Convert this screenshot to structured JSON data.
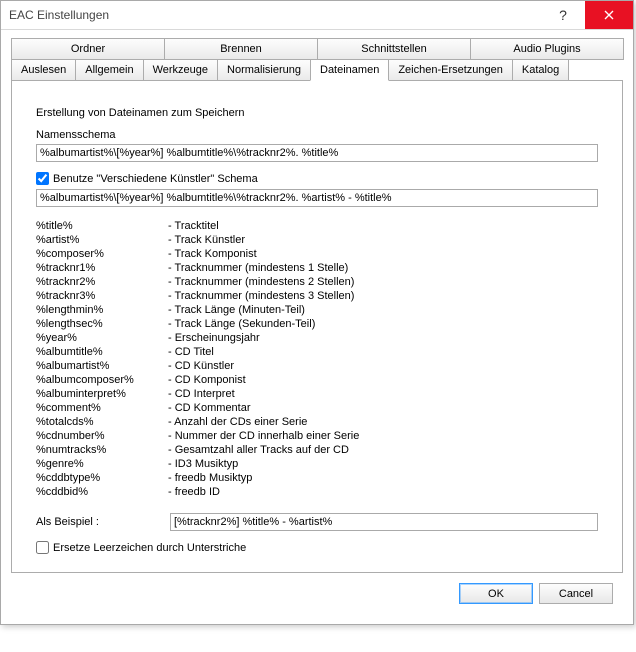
{
  "window": {
    "title": "EAC Einstellungen"
  },
  "tabsTop": {
    "t0": "Ordner",
    "t1": "Brennen",
    "t2": "Schnittstellen",
    "t3": "Audio Plugins"
  },
  "tabsBottom": {
    "t0": "Auslesen",
    "t1": "Allgemein",
    "t2": "Werkzeuge",
    "t3": "Normalisierung",
    "t4": "Dateinamen",
    "t5": "Zeichen-Ersetzungen",
    "t6": "Katalog"
  },
  "section": {
    "heading": "Erstellung von Dateinamen zum Speichern",
    "schemaLabel": "Namensschema",
    "schemaValue": "%albumartist%\\[%year%] %albumtitle%\\%tracknr2%. %title%",
    "useVariousLabel": "Benutze \"Verschiedene Künstler\" Schema",
    "variousValue": "%albumartist%\\[%year%] %albumtitle%\\%tracknr2%. %artist% - %title%",
    "exampleLabel": "Als Beispiel :",
    "exampleValue": "[%tracknr2%] %title% - %artist%",
    "replaceSpacesLabel": "Ersetze Leerzeichen durch Unterstriche"
  },
  "placeholders": [
    {
      "name": "%title%",
      "desc": "- Tracktitel"
    },
    {
      "name": "%artist%",
      "desc": "- Track Künstler"
    },
    {
      "name": "%composer%",
      "desc": "- Track Komponist"
    },
    {
      "name": "%tracknr1%",
      "desc": "- Tracknummer (mindestens 1 Stelle)"
    },
    {
      "name": "%tracknr2%",
      "desc": "- Tracknummer (mindestens 2 Stellen)"
    },
    {
      "name": "%tracknr3%",
      "desc": "- Tracknummer (mindestens 3 Stellen)"
    },
    {
      "name": "%lengthmin%",
      "desc": "- Track Länge (Minuten-Teil)"
    },
    {
      "name": "%lengthsec%",
      "desc": "- Track Länge (Sekunden-Teil)"
    },
    {
      "name": "%year%",
      "desc": "- Erscheinungsjahr"
    },
    {
      "name": "%albumtitle%",
      "desc": "- CD Titel"
    },
    {
      "name": "%albumartist%",
      "desc": "- CD Künstler"
    },
    {
      "name": "%albumcomposer%",
      "desc": "- CD Komponist"
    },
    {
      "name": "%albuminterpret%",
      "desc": "- CD Interpret"
    },
    {
      "name": "%comment%",
      "desc": "- CD Kommentar"
    },
    {
      "name": "%totalcds%",
      "desc": "- Anzahl der CDs einer Serie"
    },
    {
      "name": "%cdnumber%",
      "desc": "- Nummer der CD innerhalb einer Serie"
    },
    {
      "name": "%numtracks%",
      "desc": "- Gesamtzahl aller Tracks auf der CD"
    },
    {
      "name": "%genre%",
      "desc": "- ID3 Musiktyp"
    },
    {
      "name": "%cddbtype%",
      "desc": "- freedb Musiktyp"
    },
    {
      "name": "%cddbid%",
      "desc": "- freedb ID"
    }
  ],
  "buttons": {
    "ok": "OK",
    "cancel": "Cancel"
  }
}
